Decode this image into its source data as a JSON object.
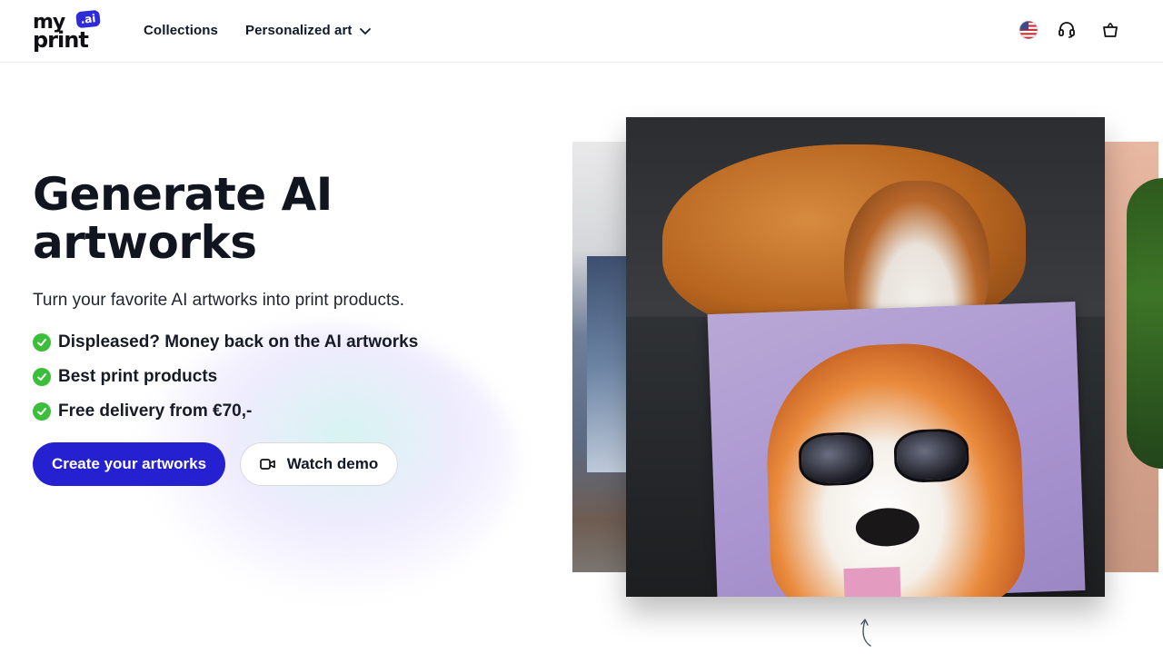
{
  "header": {
    "logo": {
      "word_top": "my",
      "word_bottom": "print",
      "badge": ".ai"
    },
    "nav": [
      {
        "label": "Collections"
      },
      {
        "label": "Personalized art"
      }
    ],
    "icons": [
      "us-flag-icon",
      "headset-support-icon",
      "shopping-bag-icon"
    ]
  },
  "hero": {
    "headline": "Generate AI artworks",
    "subtitle": "Turn your favorite AI artworks into print products.",
    "features": [
      "Displeased? Money back on the AI artworks",
      "Best print products",
      "Free delivery from €70,-"
    ],
    "primary_button": "Create your artworks",
    "secondary_button": "Watch demo"
  },
  "colors": {
    "primary": "#2621d0",
    "check": "#3bbf3b",
    "text": "#111827"
  }
}
